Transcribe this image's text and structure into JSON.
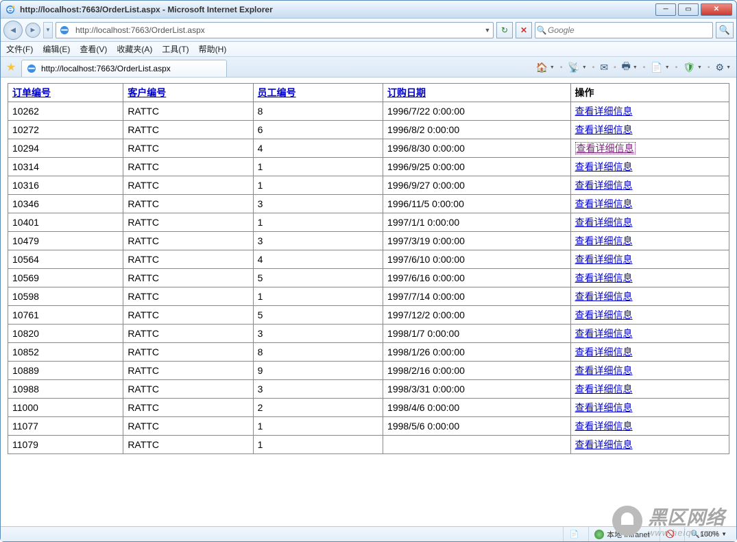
{
  "window": {
    "title": "http://localhost:7663/OrderList.aspx - Microsoft Internet Explorer"
  },
  "nav": {
    "url": "http://localhost:7663/OrderList.aspx",
    "search_placeholder": "Google"
  },
  "menu": {
    "file": "文件(F)",
    "edit": "编辑(E)",
    "view": "查看(V)",
    "favorites": "收藏夹(A)",
    "tools": "工具(T)",
    "help": "帮助(H)"
  },
  "tab": {
    "title": "http://localhost:7663/OrderList.aspx"
  },
  "table": {
    "headers": {
      "order_id": "订单编号",
      "customer_id": "客户编号",
      "employee_id": "员工编号",
      "order_date": "订购日期",
      "actions": "操作"
    },
    "action_label": "查看详细信息",
    "rows": [
      {
        "order_id": "10262",
        "customer_id": "RATTC",
        "employee_id": "8",
        "order_date": "1996/7/22 0:00:00",
        "visited": false
      },
      {
        "order_id": "10272",
        "customer_id": "RATTC",
        "employee_id": "6",
        "order_date": "1996/8/2 0:00:00",
        "visited": false
      },
      {
        "order_id": "10294",
        "customer_id": "RATTC",
        "employee_id": "4",
        "order_date": "1996/8/30 0:00:00",
        "visited": true
      },
      {
        "order_id": "10314",
        "customer_id": "RATTC",
        "employee_id": "1",
        "order_date": "1996/9/25 0:00:00",
        "visited": false
      },
      {
        "order_id": "10316",
        "customer_id": "RATTC",
        "employee_id": "1",
        "order_date": "1996/9/27 0:00:00",
        "visited": false
      },
      {
        "order_id": "10346",
        "customer_id": "RATTC",
        "employee_id": "3",
        "order_date": "1996/11/5 0:00:00",
        "visited": false
      },
      {
        "order_id": "10401",
        "customer_id": "RATTC",
        "employee_id": "1",
        "order_date": "1997/1/1 0:00:00",
        "visited": false
      },
      {
        "order_id": "10479",
        "customer_id": "RATTC",
        "employee_id": "3",
        "order_date": "1997/3/19 0:00:00",
        "visited": false
      },
      {
        "order_id": "10564",
        "customer_id": "RATTC",
        "employee_id": "4",
        "order_date": "1997/6/10 0:00:00",
        "visited": false
      },
      {
        "order_id": "10569",
        "customer_id": "RATTC",
        "employee_id": "5",
        "order_date": "1997/6/16 0:00:00",
        "visited": false
      },
      {
        "order_id": "10598",
        "customer_id": "RATTC",
        "employee_id": "1",
        "order_date": "1997/7/14 0:00:00",
        "visited": false
      },
      {
        "order_id": "10761",
        "customer_id": "RATTC",
        "employee_id": "5",
        "order_date": "1997/12/2 0:00:00",
        "visited": false
      },
      {
        "order_id": "10820",
        "customer_id": "RATTC",
        "employee_id": "3",
        "order_date": "1998/1/7 0:00:00",
        "visited": false
      },
      {
        "order_id": "10852",
        "customer_id": "RATTC",
        "employee_id": "8",
        "order_date": "1998/1/26 0:00:00",
        "visited": false
      },
      {
        "order_id": "10889",
        "customer_id": "RATTC",
        "employee_id": "9",
        "order_date": "1998/2/16 0:00:00",
        "visited": false
      },
      {
        "order_id": "10988",
        "customer_id": "RATTC",
        "employee_id": "3",
        "order_date": "1998/3/31 0:00:00",
        "visited": false
      },
      {
        "order_id": "11000",
        "customer_id": "RATTC",
        "employee_id": "2",
        "order_date": "1998/4/6 0:00:00",
        "visited": false
      },
      {
        "order_id": "11077",
        "customer_id": "RATTC",
        "employee_id": "1",
        "order_date": "1998/5/6 0:00:00",
        "visited": false
      },
      {
        "order_id": "11079",
        "customer_id": "RATTC",
        "employee_id": "1",
        "order_date": "",
        "visited": false
      }
    ]
  },
  "status": {
    "zone": "本地 Intranet",
    "zoom": "100%"
  },
  "watermark": {
    "main": "黑区网络",
    "sub": "www.heiqu.com"
  }
}
